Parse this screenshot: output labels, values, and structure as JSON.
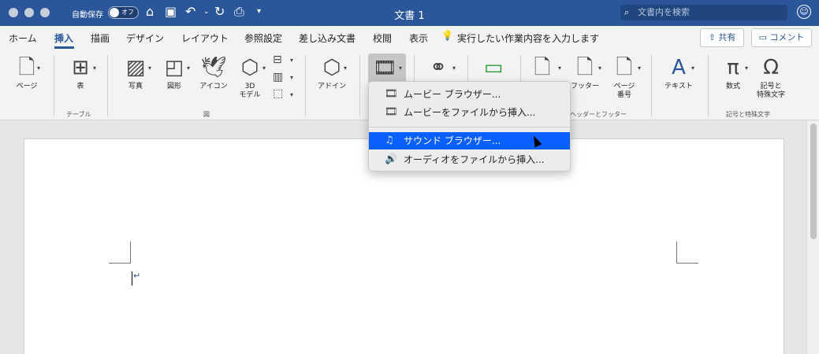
{
  "titlebar": {
    "autosave_label": "自動保存",
    "autosave_state": "オフ",
    "doc_title": "文書 1",
    "search_placeholder": "文書内を検索",
    "icons": [
      "home-icon",
      "save-icon",
      "undo-icon",
      "redo-icon",
      "print-icon",
      "customize-icon"
    ]
  },
  "tabs": [
    "ホーム",
    "挿入",
    "描画",
    "デザイン",
    "レイアウト",
    "参照設定",
    "差し込み文書",
    "校閲",
    "表示"
  ],
  "active_tab": "挿入",
  "tellme": "実行したい作業内容を入力します",
  "share": "共有",
  "comment": "コメント",
  "ribbon": {
    "page": "ページ",
    "table": "表",
    "group_table": "テーブル",
    "picture": "写真",
    "shapes": "図形",
    "icons": "アイコン",
    "models3d": "3D\nモデル",
    "group_illust": "図",
    "addins": "アドイン",
    "footer": "フッター",
    "pagenum": "ページ\n番号",
    "group_hf": "ヘッダーとフッター",
    "text": "テキスト",
    "equation": "数式",
    "symbol": "記号と\n特殊文字",
    "group_symbols": "記号と特殊文字"
  },
  "menu": {
    "items": [
      "ムービー ブラウザー...",
      "ムービーをファイルから挿入...",
      "サウンド ブラウザー...",
      "オーディオをファイルから挿入..."
    ],
    "highlighted": "サウンド ブラウザー..."
  },
  "colors": {
    "accent": "#2b579a",
    "highlight": "#0a60ff"
  }
}
